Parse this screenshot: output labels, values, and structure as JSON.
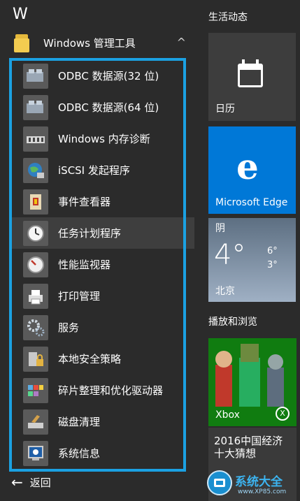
{
  "app_list": {
    "letter": "W",
    "folder": {
      "label": "Windows 管理工具",
      "chevron": "^"
    },
    "items": [
      {
        "label": "ODBC 数据源(32 位)",
        "icon": "odbc-icon"
      },
      {
        "label": "ODBC 数据源(64 位)",
        "icon": "odbc-icon"
      },
      {
        "label": "Windows 内存诊断",
        "icon": "memory-diagnostic-icon"
      },
      {
        "label": "iSCSI 发起程序",
        "icon": "iscsi-globe-icon"
      },
      {
        "label": "事件查看器",
        "icon": "event-viewer-icon"
      },
      {
        "label": "任务计划程序",
        "icon": "task-scheduler-clock-icon"
      },
      {
        "label": "性能监视器",
        "icon": "performance-monitor-icon"
      },
      {
        "label": "打印管理",
        "icon": "print-management-icon"
      },
      {
        "label": "服务",
        "icon": "services-gears-icon"
      },
      {
        "label": "本地安全策略",
        "icon": "local-security-policy-icon"
      },
      {
        "label": "碎片整理和优化驱动器",
        "icon": "defragment-icon"
      },
      {
        "label": "磁盘清理",
        "icon": "disk-cleanup-icon"
      },
      {
        "label": "系统信息",
        "icon": "system-information-icon"
      }
    ],
    "back_label": "返回"
  },
  "tiles": {
    "life_section": "生活动态",
    "calendar": "日历",
    "edge": "Microsoft Edge",
    "weather": {
      "condition": "阴",
      "temp": "4°",
      "high": "6°",
      "low": "3°",
      "city": "北京"
    },
    "play_section": "播放和浏览",
    "xbox": "Xbox",
    "news": [
      "2016中国经济",
      "十大猜想"
    ]
  },
  "watermark": {
    "title": "系统大全",
    "url": "www.XP85.com"
  },
  "colors": {
    "accent": "#1ba1e2",
    "edge_blue": "#0078d7",
    "xbox_green": "#107c10"
  }
}
